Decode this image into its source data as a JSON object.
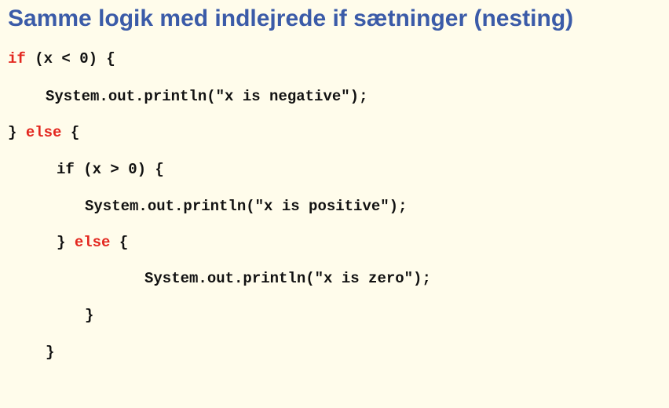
{
  "title": "Samme logik med indlejrede if sætninger (nesting)",
  "colors": {
    "background": "#fffceb",
    "title": "#3b5ba8",
    "keyword": "#e3261e",
    "code": "#111111"
  },
  "code": {
    "line1": {
      "kw": "if",
      "rest": " (x < 0) {"
    },
    "line2": {
      "text": "System.out.println(\"x is negative\");"
    },
    "line3": {
      "pre": "} ",
      "kw": "else",
      "post": " {"
    },
    "line4": {
      "text": "if (x > 0) {"
    },
    "line5": {
      "text": "System.out.println(\"x is positive\");"
    },
    "line6": {
      "pre": "} ",
      "kw": "else",
      "post": " {"
    },
    "line7": {
      "text": "System.out.println(\"x is zero\");"
    },
    "line8": {
      "text": "}"
    },
    "line9": {
      "text": "}"
    }
  }
}
